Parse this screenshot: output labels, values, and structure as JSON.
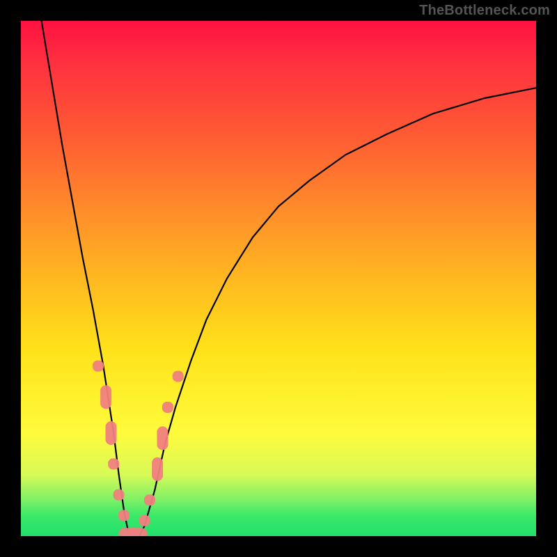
{
  "watermark": "TheBottleneck.com",
  "colors": {
    "background": "#000000",
    "curve": "#000000",
    "marker": "#F08080"
  },
  "chart_data": {
    "type": "line",
    "title": "",
    "xlabel": "",
    "ylabel": "",
    "xlim": [
      0,
      100
    ],
    "ylim": [
      0,
      100
    ],
    "grid": false,
    "legend": false,
    "series": [
      {
        "name": "bottleneck-curve",
        "x": [
          4,
          6,
          8,
          10,
          12,
          14,
          16,
          18,
          19,
          20,
          21,
          22,
          23,
          24,
          26,
          28,
          30,
          33,
          36,
          40,
          45,
          50,
          56,
          63,
          71,
          80,
          90,
          100
        ],
        "y": [
          100,
          88,
          76,
          65,
          54,
          44,
          33,
          20,
          12,
          5,
          0,
          0,
          0,
          2,
          9,
          18,
          25,
          34,
          42,
          50,
          58,
          64,
          69,
          74,
          78,
          82,
          85,
          87
        ]
      }
    ],
    "markers": [
      {
        "x": 15.0,
        "y": 33.0,
        "shape": "rounded"
      },
      {
        "x": 16.5,
        "y": 27.0,
        "shape": "rounded-long"
      },
      {
        "x": 17.5,
        "y": 20.0,
        "shape": "rounded-long"
      },
      {
        "x": 18.0,
        "y": 14.0,
        "shape": "rounded"
      },
      {
        "x": 19.0,
        "y": 8.0,
        "shape": "rounded"
      },
      {
        "x": 20.0,
        "y": 4.0,
        "shape": "rounded"
      },
      {
        "x": 21.0,
        "y": 0.5,
        "shape": "rounded-long-h"
      },
      {
        "x": 22.5,
        "y": 0.5,
        "shape": "rounded-long-h"
      },
      {
        "x": 24.0,
        "y": 3.0,
        "shape": "rounded"
      },
      {
        "x": 25.0,
        "y": 7.0,
        "shape": "rounded"
      },
      {
        "x": 26.5,
        "y": 13.0,
        "shape": "rounded-long"
      },
      {
        "x": 27.5,
        "y": 19.0,
        "shape": "rounded-long"
      },
      {
        "x": 28.5,
        "y": 25.0,
        "shape": "rounded"
      },
      {
        "x": 30.5,
        "y": 31.0,
        "shape": "rounded"
      }
    ],
    "gradient_stops": [
      {
        "pos": 0.0,
        "color": "#ff113f"
      },
      {
        "pos": 0.08,
        "color": "#ff3040"
      },
      {
        "pos": 0.22,
        "color": "#ff5a33"
      },
      {
        "pos": 0.36,
        "color": "#ff8a2b"
      },
      {
        "pos": 0.5,
        "color": "#ffb820"
      },
      {
        "pos": 0.64,
        "color": "#ffe31a"
      },
      {
        "pos": 0.8,
        "color": "#fffb3c"
      },
      {
        "pos": 0.88,
        "color": "#d8fa57"
      },
      {
        "pos": 0.93,
        "color": "#7df066"
      },
      {
        "pos": 0.96,
        "color": "#3ce96a"
      },
      {
        "pos": 1.0,
        "color": "#21e06b"
      }
    ]
  }
}
